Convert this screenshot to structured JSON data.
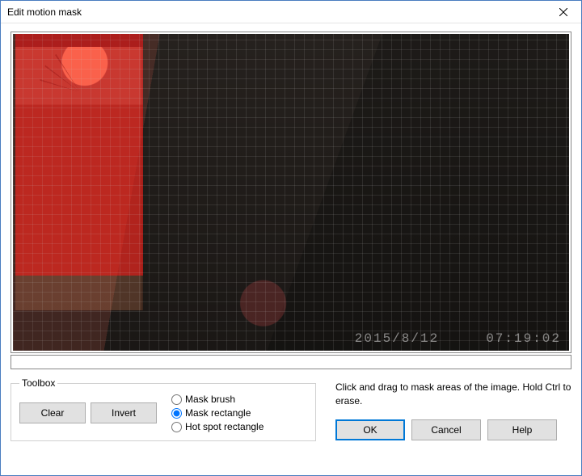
{
  "window": {
    "title": "Edit motion mask"
  },
  "preview": {
    "timestamp": "2015/8/12     07:19:02"
  },
  "toolbox": {
    "legend": "Toolbox",
    "clear_label": "Clear",
    "invert_label": "Invert",
    "radios": {
      "brush": "Mask brush",
      "rect": "Mask rectangle",
      "hotspot": "Hot spot rectangle",
      "selected": "rect"
    }
  },
  "hint_text": "Click and drag to mask areas of the image.  Hold Ctrl to erase.",
  "buttons": {
    "ok": "OK",
    "cancel": "Cancel",
    "help": "Help"
  }
}
